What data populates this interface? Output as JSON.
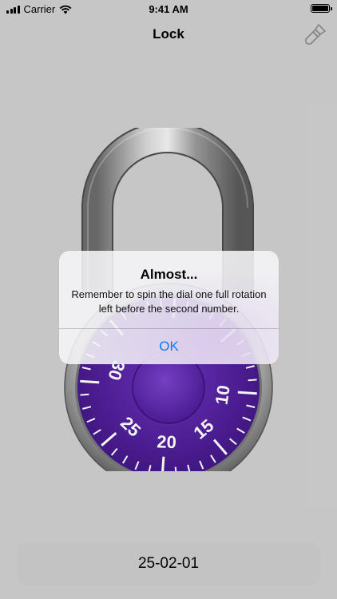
{
  "status_bar": {
    "carrier": "Carrier",
    "time": "9:41 AM",
    "battery_level": 1.0
  },
  "nav": {
    "title": "Lock",
    "action_icon": "paintbrush-icon"
  },
  "lock": {
    "dial_color": "#5b24a8",
    "dial_numbers": [
      "30",
      "25",
      "20",
      "15",
      "10"
    ]
  },
  "alert": {
    "title": "Almost...",
    "message": "Remember to spin the dial one full rotation left before the second number.",
    "ok_label": "OK",
    "button_color": "#0a7aff"
  },
  "combination": {
    "value": "25-02-01"
  }
}
